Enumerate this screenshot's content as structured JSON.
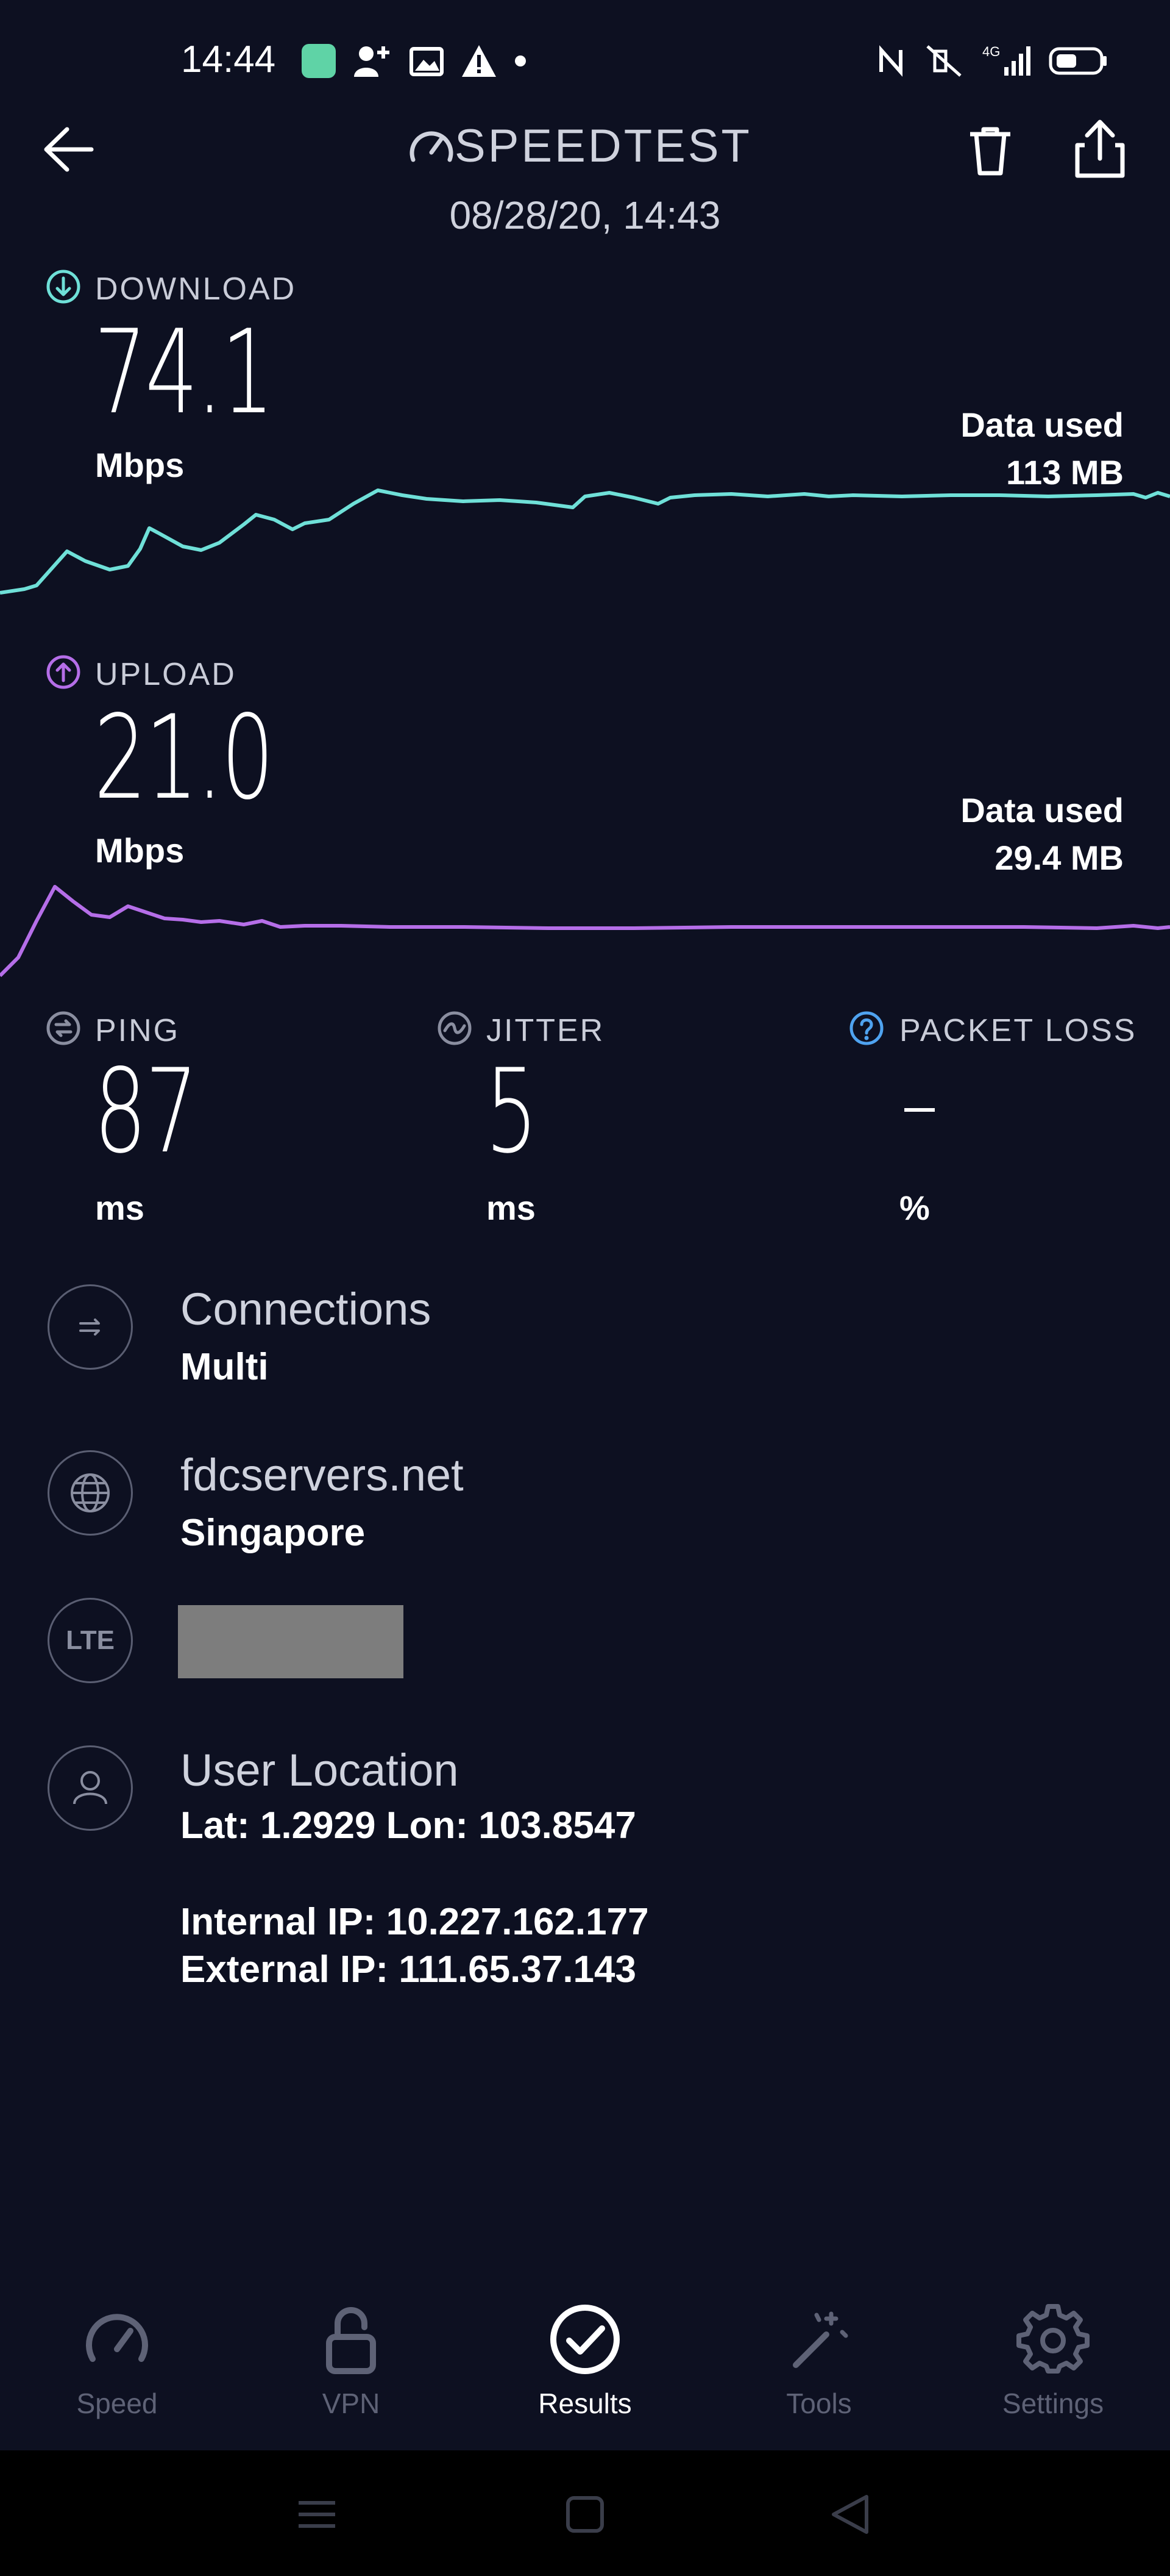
{
  "status_bar": {
    "time": "14:44",
    "left_icons": [
      "app-notification-icon",
      "add-contact-icon",
      "gallery-icon",
      "warning-icon",
      "dot-icon"
    ],
    "right_icons": [
      "nfc-icon",
      "mute-icon",
      "signal-4g-icon",
      "battery-icon"
    ]
  },
  "header": {
    "title": "SPEEDTEST",
    "date": "08/28/20, 14:43"
  },
  "download": {
    "label": "DOWNLOAD",
    "value": "74.1",
    "unit": "Mbps",
    "data_used_label": "Data used",
    "data_used_value": "113 MB",
    "color": "#6fe0d8"
  },
  "upload": {
    "label": "UPLOAD",
    "value": "21.0",
    "unit": "Mbps",
    "data_used_label": "Data used",
    "data_used_value": "29.4 MB",
    "color": "#b56ee8"
  },
  "ping": {
    "label": "PING",
    "value": "87",
    "unit": "ms"
  },
  "jitter": {
    "label": "JITTER",
    "value": "5",
    "unit": "ms"
  },
  "packet_loss": {
    "label": "PACKET LOSS",
    "value": "–",
    "unit": "%"
  },
  "connections": {
    "title": "Connections",
    "value": "Multi"
  },
  "server": {
    "title": "fdcservers.net",
    "location": "Singapore"
  },
  "network": {
    "badge": "LTE"
  },
  "user_location": {
    "title": "User Location",
    "coords": "Lat: 1.2929 Lon: 103.8547",
    "internal_ip": "Internal IP: 10.227.162.177",
    "external_ip": "External IP: 111.65.37.143"
  },
  "tabs": [
    {
      "label": "Speed",
      "icon": "speedometer-icon"
    },
    {
      "label": "VPN",
      "icon": "unlock-icon"
    },
    {
      "label": "Results",
      "icon": "check-circle-icon",
      "active": true
    },
    {
      "label": "Tools",
      "icon": "magic-wand-icon"
    },
    {
      "label": "Settings",
      "icon": "gear-icon"
    }
  ]
}
